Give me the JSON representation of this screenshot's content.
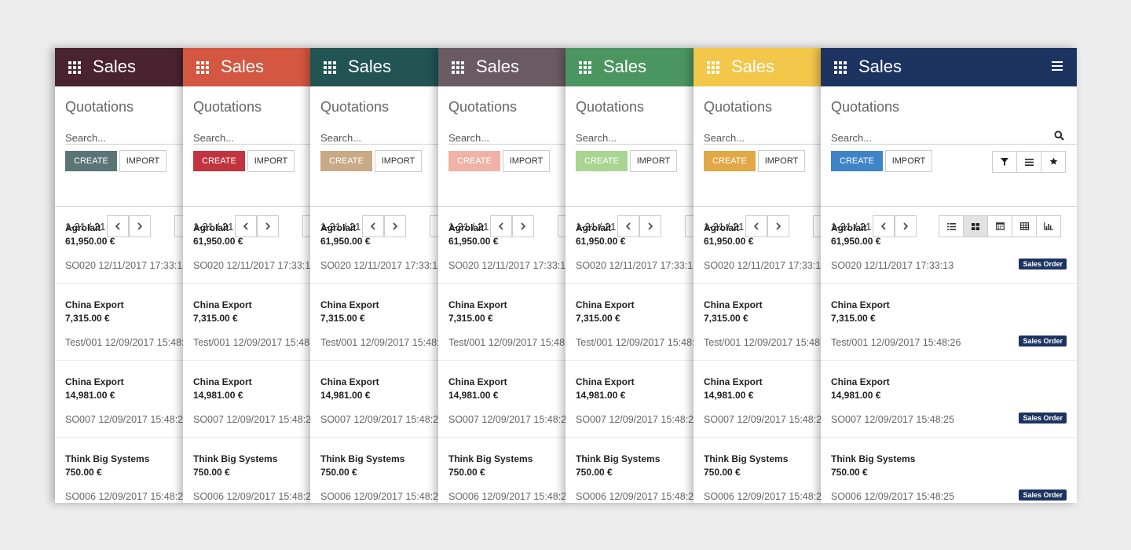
{
  "app": {
    "title": "Sales",
    "breadcrumb": "Quotations",
    "search_placeholder": "Search...",
    "create_label": "CREATE",
    "import_label": "IMPORT",
    "pager": "1-21 / 21"
  },
  "themes": [
    {
      "header": "#4a2330",
      "create": "#5b7477"
    },
    {
      "header": "#d35741",
      "create": "#c1343f"
    },
    {
      "header": "#225454",
      "create": "#c8aa86"
    },
    {
      "header": "#6a5a61",
      "create": "#eeb3a6"
    },
    {
      "header": "#4b9560",
      "create": "#a8d592"
    },
    {
      "header": "#f2c74a",
      "create": "#e1a846"
    },
    {
      "header": "#1d3461",
      "create": "#3e84c7"
    }
  ],
  "icons": {
    "apps": "apps-icon",
    "menu": "menu-icon",
    "search": "search-icon",
    "filter": "filter-icon",
    "group_by": "group-by-icon",
    "favorites": "star-icon",
    "views": [
      "list-view-icon",
      "kanban-view-icon",
      "calendar-view-icon",
      "pivot-view-icon",
      "graph-view-icon"
    ]
  },
  "records": [
    {
      "name": "Agrolait",
      "amount": "61,950.00 €",
      "ref": "SO020 12/11/2017 17:33:13",
      "badge": "Sales Order"
    },
    {
      "name": "China Export",
      "amount": "7,315.00 €",
      "ref": "Test/001 12/09/2017 15:48:26",
      "badge": "Sales Order"
    },
    {
      "name": "China Export",
      "amount": "14,981.00 €",
      "ref": "SO007 12/09/2017 15:48:25",
      "badge": "Sales Order"
    },
    {
      "name": "Think Big Systems",
      "amount": "750.00 €",
      "ref": "SO006 12/09/2017 15:48:25",
      "badge": "Sales Order"
    }
  ]
}
